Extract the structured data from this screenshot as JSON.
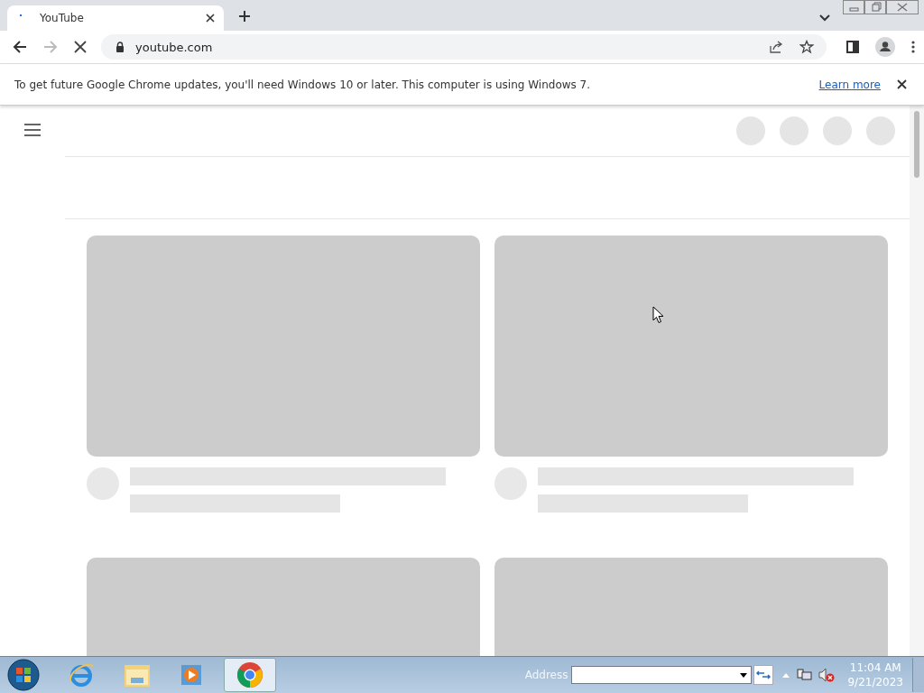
{
  "tab": {
    "title": "YouTube",
    "selected": true
  },
  "address_bar": {
    "url": "youtube.com"
  },
  "infobar": {
    "message": "To get future Google Chrome updates, you'll need Windows 10 or later. This computer is using Windows 7.",
    "link": "Learn more"
  },
  "taskbar": {
    "address_label": "Address",
    "clock": {
      "time": "11:04 AM",
      "date": "9/21/2023"
    }
  }
}
